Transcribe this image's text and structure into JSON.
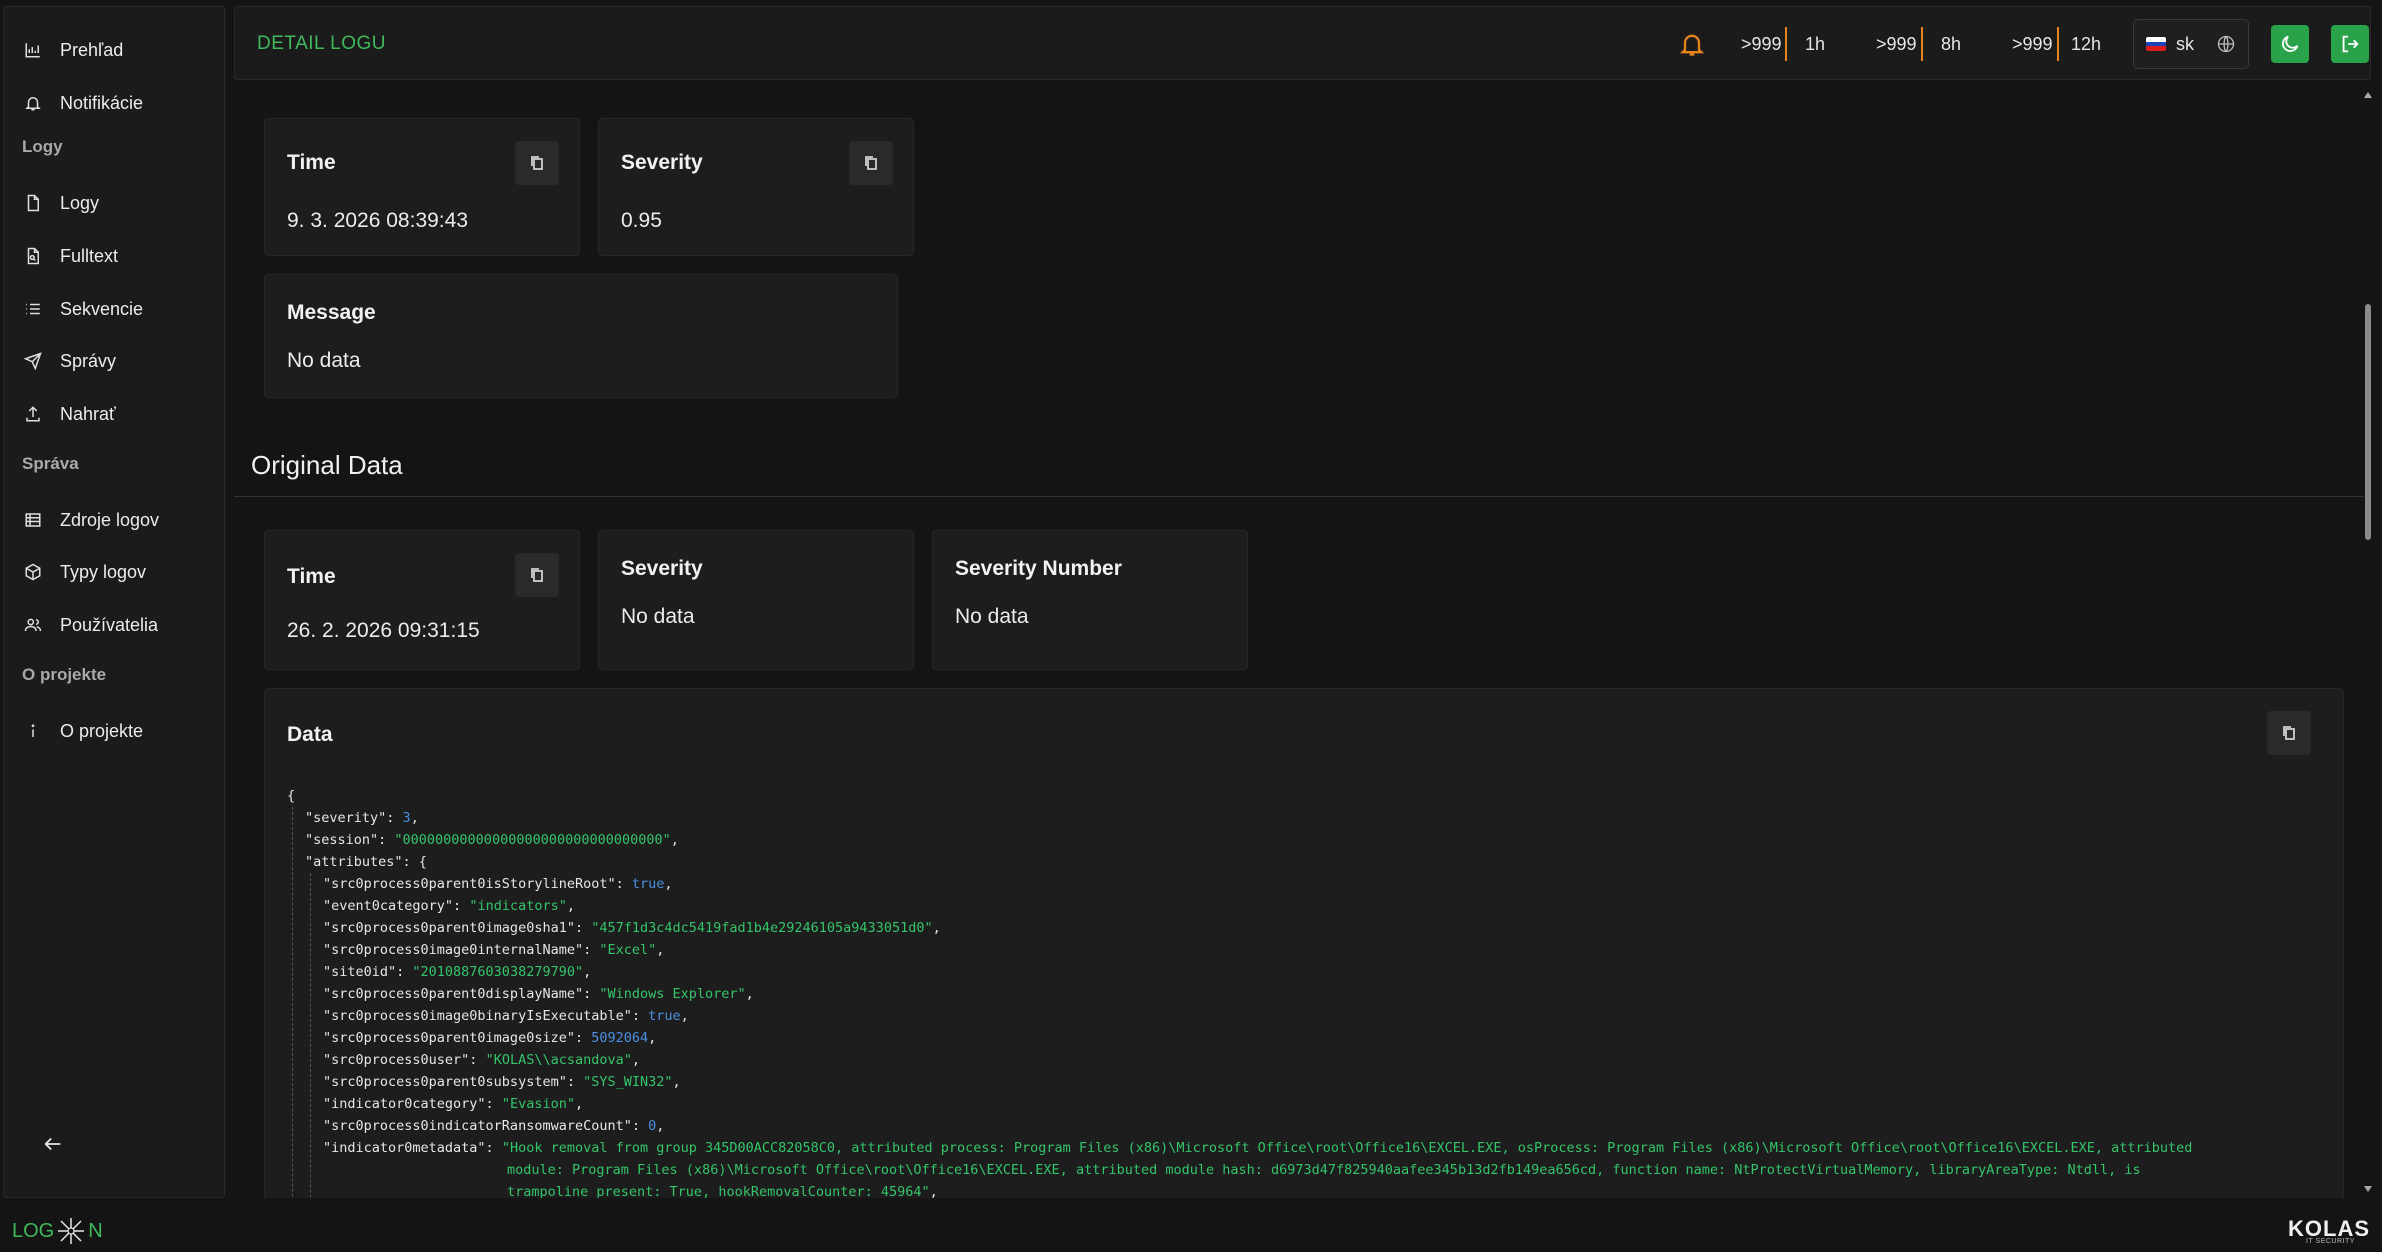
{
  "sidebar": {
    "items": [
      {
        "label": "Prehľad",
        "icon": "chart-bar-icon"
      },
      {
        "label": "Notifikácie",
        "icon": "bell-icon"
      },
      {
        "label": "Logy",
        "icon": "file-icon"
      },
      {
        "label": "Fulltext",
        "icon": "file-search-icon"
      },
      {
        "label": "Sekvencie",
        "icon": "list-icon"
      },
      {
        "label": "Správy",
        "icon": "send-icon"
      },
      {
        "label": "Nahrať",
        "icon": "upload-icon"
      },
      {
        "label": "Zdroje logov",
        "icon": "table-icon"
      },
      {
        "label": "Typy logov",
        "icon": "cube-icon"
      },
      {
        "label": "Používatelia",
        "icon": "users-icon"
      },
      {
        "label": "O projekte",
        "icon": "info-icon"
      }
    ],
    "sections": [
      "Logy",
      "Správa",
      "O projekte"
    ]
  },
  "header": {
    "title": "DETAIL LOGU",
    "stats": [
      {
        "count": ">999",
        "period": "1h"
      },
      {
        "count": ">999",
        "period": "8h"
      },
      {
        "count": ">999",
        "period": "12h"
      }
    ],
    "language": "sk",
    "accent_color": "#3fb95b",
    "warning_color": "#e6841c"
  },
  "parsed": {
    "time_label": "Time",
    "time_value": "9. 3. 2026 08:39:43",
    "severity_label": "Severity",
    "severity_value": "0.95",
    "message_label": "Message",
    "message_value": "No data"
  },
  "original": {
    "section_title": "Original Data",
    "time_label": "Time",
    "time_value": "26. 2. 2026 09:31:15",
    "severity_label": "Severity",
    "severity_value": "No data",
    "severity_number_label": "Severity Number",
    "severity_number_value": "No data",
    "data_label": "Data"
  },
  "json_lines": [
    {
      "indent": 0,
      "parts": [
        [
          "p",
          "{"
        ]
      ]
    },
    {
      "indent": 1,
      "parts": [
        [
          "k",
          "\"severity\": "
        ],
        [
          "n",
          "3"
        ],
        [
          "p",
          ","
        ]
      ]
    },
    {
      "indent": 1,
      "parts": [
        [
          "k",
          "\"session\": "
        ],
        [
          "s",
          "\"00000000000000000000000000000000\""
        ],
        [
          "p",
          ","
        ]
      ]
    },
    {
      "indent": 1,
      "parts": [
        [
          "k",
          "\"attributes\": {"
        ]
      ]
    },
    {
      "indent": 2,
      "parts": [
        [
          "k",
          "\"src0process0parent0isStorylineRoot\": "
        ],
        [
          "b",
          "true"
        ],
        [
          "p",
          ","
        ]
      ]
    },
    {
      "indent": 2,
      "parts": [
        [
          "k",
          "\"event0category\": "
        ],
        [
          "s",
          "\"indicators\""
        ],
        [
          "p",
          ","
        ]
      ]
    },
    {
      "indent": 2,
      "parts": [
        [
          "k",
          "\"src0process0parent0image0sha1\": "
        ],
        [
          "s",
          "\"457f1d3c4dc5419fad1b4e29246105a9433051d0\""
        ],
        [
          "p",
          ","
        ]
      ]
    },
    {
      "indent": 2,
      "parts": [
        [
          "k",
          "\"src0process0image0internalName\": "
        ],
        [
          "s",
          "\"Excel\""
        ],
        [
          "p",
          ","
        ]
      ]
    },
    {
      "indent": 2,
      "parts": [
        [
          "k",
          "\"site0id\": "
        ],
        [
          "s",
          "\"2010887603038279790\""
        ],
        [
          "p",
          ","
        ]
      ]
    },
    {
      "indent": 2,
      "parts": [
        [
          "k",
          "\"src0process0parent0displayName\": "
        ],
        [
          "s",
          "\"Windows Explorer\""
        ],
        [
          "p",
          ","
        ]
      ]
    },
    {
      "indent": 2,
      "parts": [
        [
          "k",
          "\"src0process0image0binaryIsExecutable\": "
        ],
        [
          "b",
          "true"
        ],
        [
          "p",
          ","
        ]
      ]
    },
    {
      "indent": 2,
      "parts": [
        [
          "k",
          "\"src0process0parent0image0size\": "
        ],
        [
          "n",
          "5092064"
        ],
        [
          "p",
          ","
        ]
      ]
    },
    {
      "indent": 2,
      "parts": [
        [
          "k",
          "\"src0process0user\": "
        ],
        [
          "s",
          "\"KOLAS\\\\acsandova\""
        ],
        [
          "p",
          ","
        ]
      ]
    },
    {
      "indent": 2,
      "parts": [
        [
          "k",
          "\"src0process0parent0subsystem\": "
        ],
        [
          "s",
          "\"SYS_WIN32\""
        ],
        [
          "p",
          ","
        ]
      ]
    },
    {
      "indent": 2,
      "parts": [
        [
          "k",
          "\"indicator0category\": "
        ],
        [
          "s",
          "\"Evasion\""
        ],
        [
          "p",
          ","
        ]
      ]
    },
    {
      "indent": 2,
      "parts": [
        [
          "k",
          "\"src0process0indicatorRansomwareCount\": "
        ],
        [
          "n",
          "0"
        ],
        [
          "p",
          ","
        ]
      ]
    },
    {
      "indent": 2,
      "parts": [
        [
          "k",
          "\"indicator0metadata\": "
        ],
        [
          "s",
          "\"Hook removal from group 345D00ACC82058C0, attributed process: Program Files (x86)\\Microsoft Office\\root\\Office16\\EXCEL.EXE, osProcess: Program Files (x86)\\Microsoft Office\\root\\Office16\\EXCEL.EXE, attributed"
        ]
      ]
    },
    {
      "indent": 2,
      "cont": true,
      "parts": [
        [
          "s",
          "module: Program Files (x86)\\Microsoft Office\\root\\Office16\\EXCEL.EXE, attributed module hash: d6973d47f825940aafee345b13d2fb149ea656cd, function name: NtProtectVirtualMemory, libraryAreaType: Ntdll, is"
        ]
      ]
    },
    {
      "indent": 2,
      "cont": true,
      "parts": [
        [
          "s",
          "trampoline present: True, hookRemovalCounter: 45964\""
        ],
        [
          "p",
          ","
        ]
      ]
    }
  ],
  "footer": {
    "left_logo": [
      "LOG",
      "N"
    ],
    "right_logo": "KOLAS",
    "right_sub": "IT SECURITY"
  }
}
